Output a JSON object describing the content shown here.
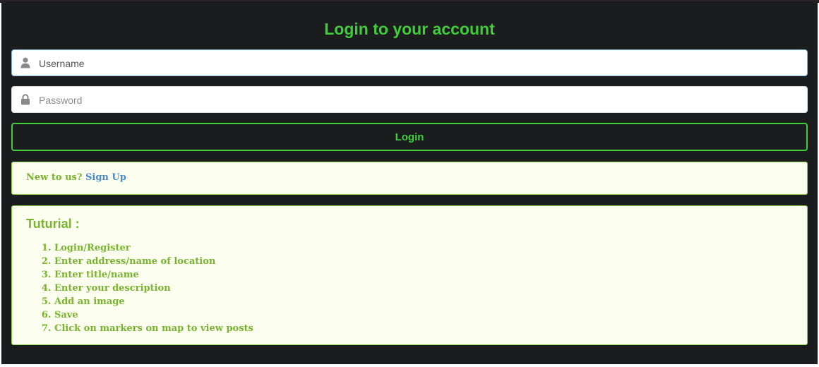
{
  "modal": {
    "title": "Login to your account"
  },
  "form": {
    "username_placeholder": "Username",
    "password_placeholder": "Password",
    "username_icon": "user-icon",
    "password_icon": "lock-icon",
    "login_label": "Login"
  },
  "signup": {
    "prompt": "New to us?",
    "link_label": "Sign Up"
  },
  "tutorial": {
    "title": "Tuturial :",
    "steps": [
      "Login/Register",
      "Enter address/name of location",
      "Enter title/name",
      "Enter your description",
      "Add an image",
      "Save",
      "Click on markers on map to view posts"
    ]
  },
  "colors": {
    "accent_green": "#3fce3a",
    "message_text": "#7ab42f",
    "message_bg": "#fbfdef",
    "link_blue": "#4b8cc8",
    "modal_bg": "#1b1c1d"
  }
}
